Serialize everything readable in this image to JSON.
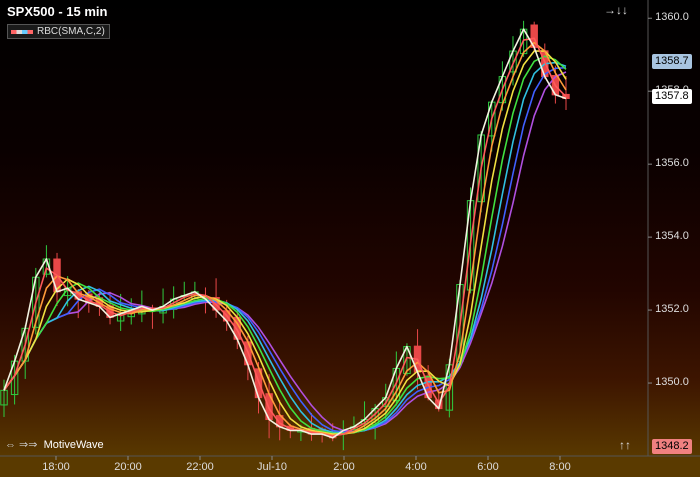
{
  "window": {
    "title": "SPX500 - 15 min"
  },
  "study_legend": {
    "label": "RBC(SMA,C,2)"
  },
  "watermark": {
    "arrows": "⇔ ⇒⇒",
    "label": "MotiveWave"
  },
  "nav": {
    "top_right": "→↓↓",
    "bottom_right": "↑↑"
  },
  "price_badges": {
    "last": {
      "value": "1357.8",
      "color": "#ffffff"
    },
    "average": {
      "value": "1358.7",
      "color": "#a8c4e0"
    },
    "low": {
      "value": "1348.2",
      "color": "#f08080"
    }
  },
  "colors": {
    "up_candle": "#2ecc40",
    "down_candle": "#e84848",
    "price_line": "#f2f2e0",
    "bands": [
      "#ff5a5a",
      "#ff9a3a",
      "#f0e040",
      "#40e040",
      "#30c0e0",
      "#4060ff",
      "#b050e0"
    ]
  },
  "chart_data": {
    "type": "candlestick",
    "title": "SPX500 - 15 min",
    "study": "RBC(SMA,C,2)",
    "x_ticks": [
      "18:00",
      "20:00",
      "22:00",
      "Jul-10",
      "2:00",
      "4:00",
      "6:00",
      "8:00"
    ],
    "y_ticks": [
      "1360.0",
      "1358.0",
      "1356.0",
      "1354.0",
      "1352.0",
      "1350.0"
    ],
    "ylim": [
      1348.0,
      1360.5
    ],
    "close_path": [
      1349.8,
      1350.6,
      1351.5,
      1352.9,
      1353.4,
      1352.5,
      1352.6,
      1352.3,
      1352.2,
      1352.1,
      1351.8,
      1351.9,
      1352.0,
      1352.1,
      1352.0,
      1352.1,
      1352.3,
      1352.4,
      1352.5,
      1352.3,
      1352.0,
      1351.7,
      1351.2,
      1350.5,
      1349.6,
      1349.0,
      1348.8,
      1348.7,
      1348.7,
      1348.6,
      1348.6,
      1348.5,
      1348.7,
      1348.8,
      1349.0,
      1349.3,
      1349.6,
      1350.4,
      1351.0,
      1350.3,
      1349.6,
      1349.3,
      1350.5,
      1352.7,
      1355.0,
      1356.8,
      1357.7,
      1358.4,
      1359.1,
      1359.7,
      1359.2,
      1358.4,
      1357.9,
      1357.8
    ]
  }
}
